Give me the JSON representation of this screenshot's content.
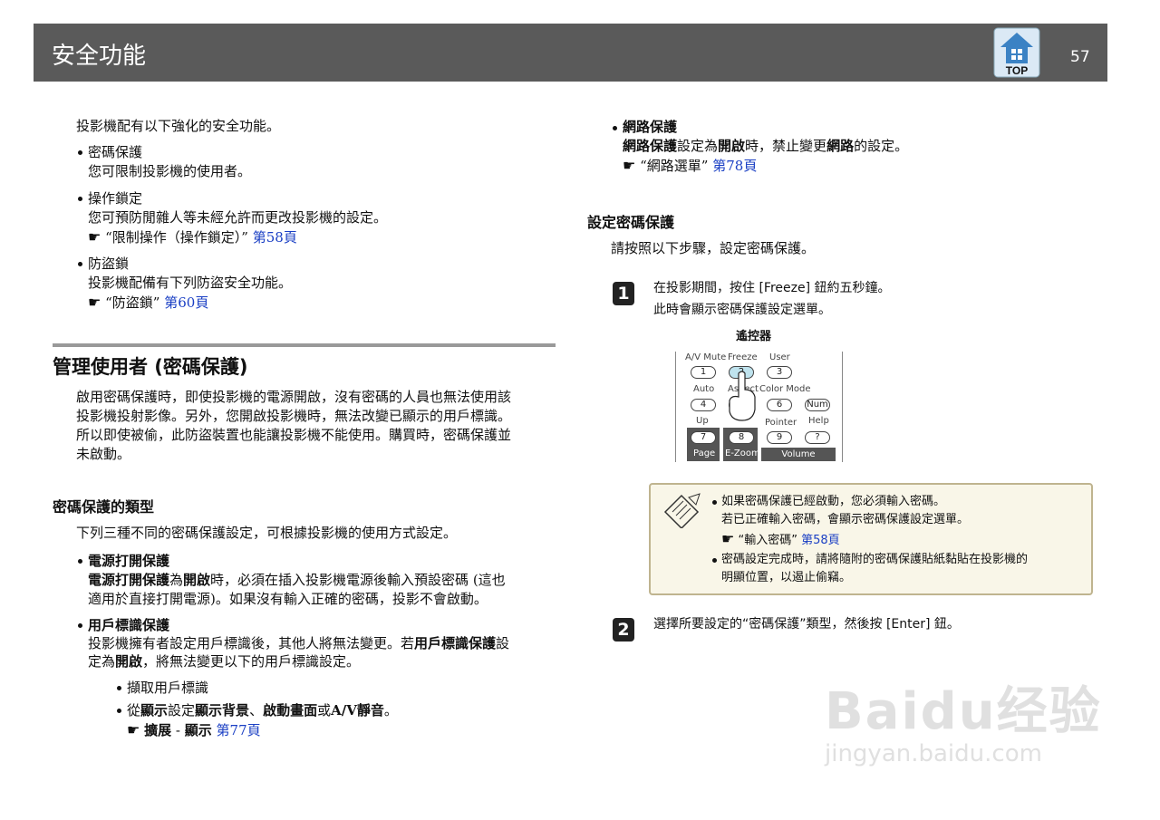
{
  "header": {
    "title": "安全功能",
    "top_label": "TOP",
    "page_number": "57"
  },
  "intro": "投影機配有以下強化的安全功能。",
  "features": [
    {
      "title": "密碼保護",
      "desc": "您可限制投影機的使用者。"
    },
    {
      "title": "操作鎖定",
      "desc": "您可預防閒雜人等未經允許而更改投影機的設定。",
      "ref_text": "“限制操作（操作鎖定）”",
      "ref_page": "第58頁"
    },
    {
      "title": "防盜鎖",
      "desc": "投影機配備有下列防盜安全功能。",
      "ref_text": "“防盜鎖”",
      "ref_page": "第60頁"
    }
  ],
  "section": {
    "title": "管理使用者 (密碼保護)",
    "para": [
      "啟用密碼保護時，即使投影機的電源開啟，沒有密碼的人員也無法使用該",
      "投影機投射影像。另外，您開啟投影機時，無法改變已顯示的用戶標識。",
      "所以即使被偷，此防盜裝置也能讓投影機不能使用。購買時，密碼保護並",
      "未啟動。"
    ]
  },
  "types": {
    "heading": "密碼保護的類型",
    "intro": "下列三種不同的密碼保護設定，可根據投影機的使用方式設定。",
    "power": {
      "title": "電源打開保護",
      "b1": "電源打開保護",
      "t1": "為",
      "b2": "開啟",
      "t2": "時，必須在插入投影機電源後輸入預設密碼 (這也",
      "line2": "適用於直接打開電源)。如果沒有輸入正確的密碼，投影不會啟動。"
    },
    "user": {
      "title": "用戶標識保護",
      "line1a": "投影機擁有者設定用戶標識後，其他人將無法變更。若",
      "line1b": "用戶標識保護",
      "line1c": "設",
      "line2a": "定為",
      "line2b": "開啟",
      "line2c": "，將無法變更以下的用戶標識設定。",
      "sub1": "擷取用戶標識",
      "sub2a": "從",
      "sub2b": "顯示",
      "sub2c": "設定",
      "sub2d": "顯示背景",
      "sub2e": "、",
      "sub2f": "啟動畫面",
      "sub2g": "或",
      "sub2h": "A/V靜音",
      "sub2i": "。",
      "ref_b1": "擴展",
      "ref_sep": " - ",
      "ref_b2": "顯示",
      "ref_page": "第77頁"
    }
  },
  "network": {
    "title": "網路保護",
    "b1": "網路保護",
    "t1": "設定為",
    "b2": "開啟",
    "t2": "時，禁止變更",
    "b3": "網路",
    "t3": "的設定。",
    "ref_text": "“網路選單”",
    "ref_page": "第78頁"
  },
  "setpw": {
    "heading": "設定密碼保護",
    "intro": "請按照以下步驟，設定密碼保護。",
    "step1": {
      "num": "1",
      "line1": "在投影期間，按住 [Freeze] 鈕約五秒鐘。",
      "line2": "此時會顯示密碼保護設定選單。"
    },
    "remote": {
      "label": "遙控器",
      "r1": [
        "A/V Mute",
        "Freeze",
        "User"
      ],
      "k1": [
        "1",
        "2",
        "3"
      ],
      "r2": [
        "Auto",
        "Aspect",
        "Color Mode"
      ],
      "k2": [
        "4",
        "5",
        "6",
        "Num"
      ],
      "r3": [
        "Up",
        "Pointer",
        "Help"
      ],
      "k3": [
        "7",
        "8",
        "9",
        "?"
      ],
      "dk": [
        "Page",
        "E-Zoom",
        "Volume"
      ]
    },
    "note": {
      "l1": "如果密碼保護已經啟動，您必須輸入密碼。",
      "l2": "若已正確輸入密碼，會顯示密碼保護設定選單。",
      "ref_text": "“輸入密碼”",
      "ref_page": "第58頁",
      "l3": "密碼設定完成時，請將隨附的密碼保護貼紙黏貼在投影機的",
      "l4": "明顯位置，以遏止偷竊。"
    },
    "step2": {
      "num": "2",
      "line1": "選擇所要設定的“密碼保護”類型，然後按 [Enter] 鈕。"
    }
  },
  "watermark": {
    "line1": "Baidu经验",
    "line2": "jingyan.baidu.com"
  },
  "icons": {
    "hand": "pointing-hand-icon",
    "top": "top-home-icon",
    "note": "memo-pencil-icon"
  }
}
